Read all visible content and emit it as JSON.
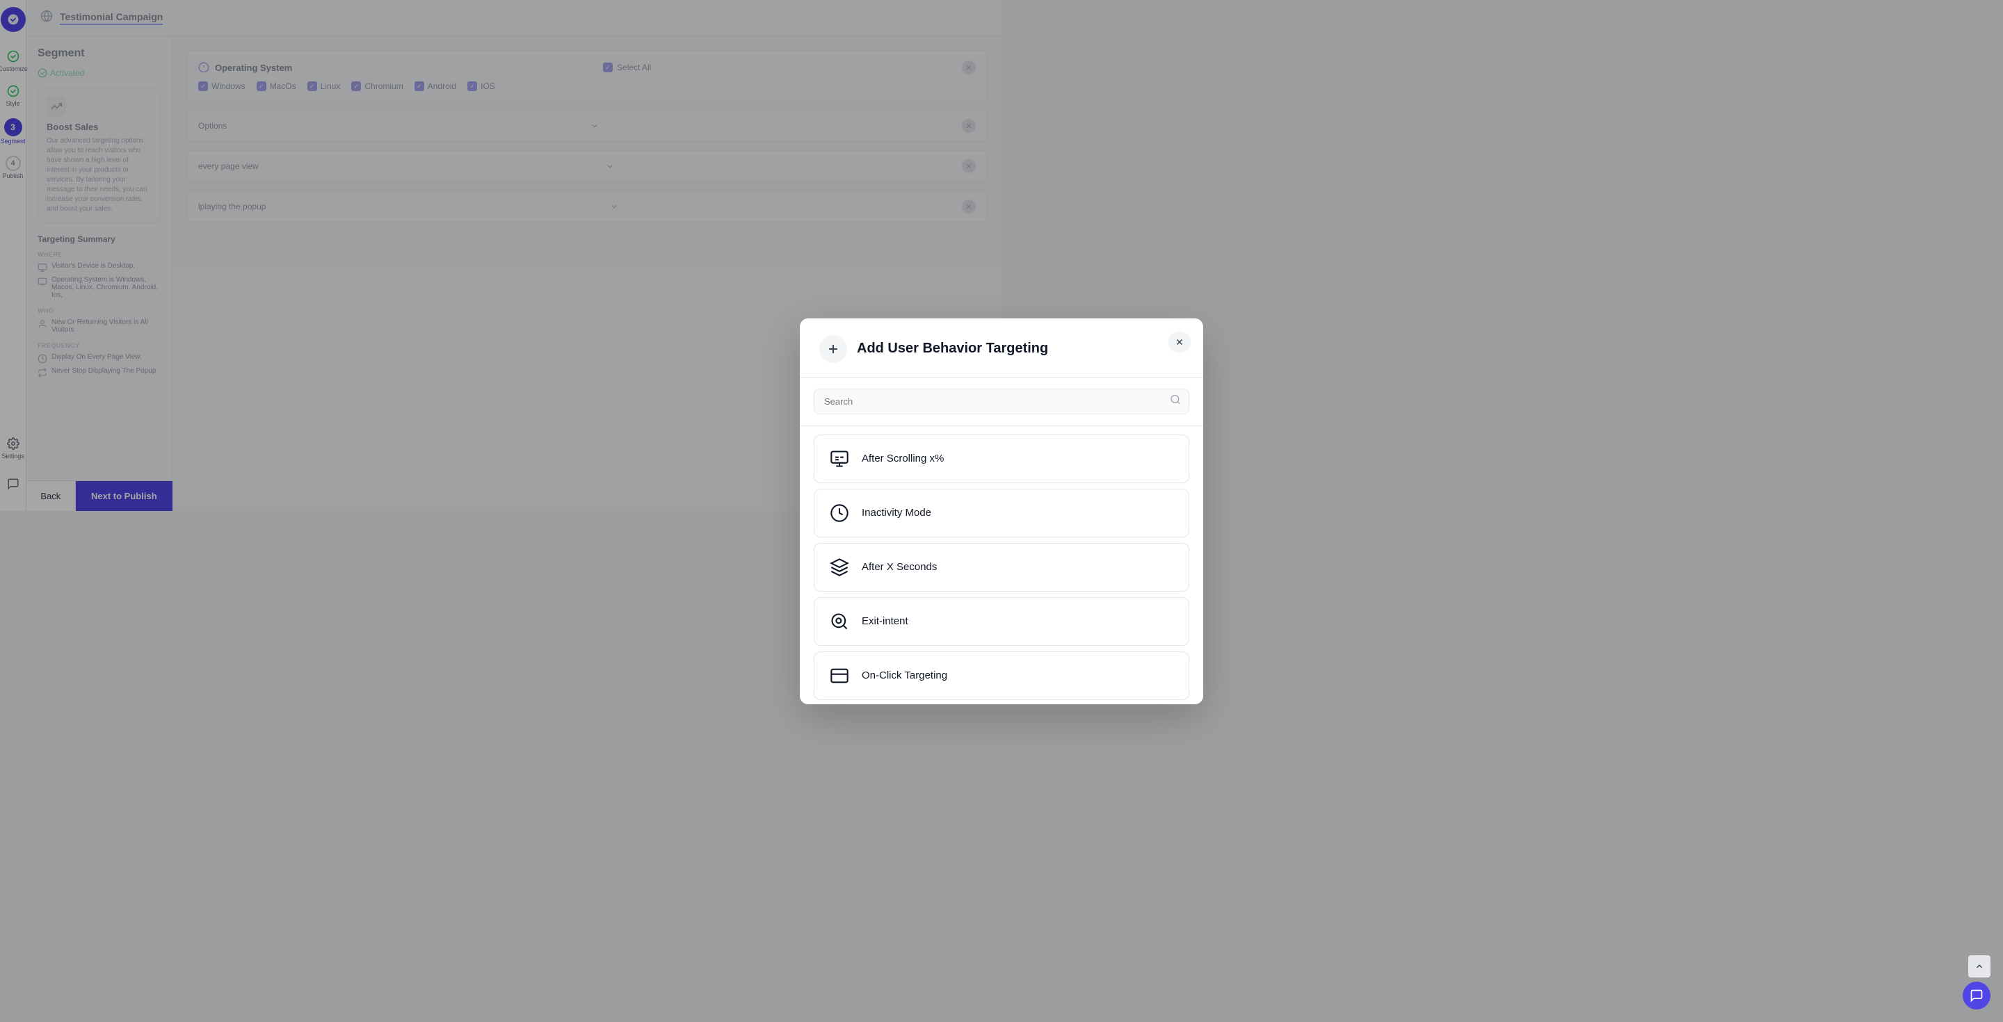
{
  "header": {
    "title": "Testimonial Campaign"
  },
  "sidebar": {
    "logo_label": "App Logo",
    "items": [
      {
        "label": "Customize",
        "icon": "check-circle",
        "step": null
      },
      {
        "label": "Style",
        "icon": "check-circle",
        "step": null
      },
      {
        "label": "Segment",
        "icon": null,
        "step": "3",
        "active": true
      },
      {
        "label": "Publish",
        "icon": null,
        "step": "4"
      }
    ],
    "bottom_items": [
      {
        "label": "Settings",
        "icon": "gear"
      }
    ]
  },
  "left_panel": {
    "title": "Segment",
    "activated_label": "Activated",
    "boost_sales": {
      "title": "Boost Sales",
      "description": "Our advanced targeting options allow you to reach visitors who have shown a high level of interest in your products or services. By tailoring your message to their needs, you can increase your conversion rates and boost your sales."
    },
    "targeting_summary": {
      "title": "Targeting Summary",
      "sections": [
        {
          "label": "WHERE",
          "items": [
            "Visitor's Device is Desktop,",
            "Operating System is Windows, Macos, Linux, Chromium, Android, Ios,"
          ]
        },
        {
          "label": "WHO",
          "items": [
            "New Or Returning Visitors is All Visitors"
          ]
        },
        {
          "label": "FREQUENCY",
          "items": [
            "Display On Every Page View.",
            "Never Stop Displaying The Popup"
          ]
        }
      ]
    }
  },
  "right_content": {
    "os_section": {
      "label": "Operating System",
      "select_all": "Select All",
      "options": [
        "Windows",
        "MacOs",
        "Linux",
        "Chromium",
        "Android",
        "IOS"
      ]
    }
  },
  "modal": {
    "title": "Add User Behavior Targeting",
    "search_placeholder": "Search",
    "close_label": "Close",
    "items": [
      {
        "id": "after-scrolling",
        "label": "After Scrolling x%",
        "icon": "scroll"
      },
      {
        "id": "inactivity-mode",
        "label": "Inactivity Mode",
        "icon": "clock"
      },
      {
        "id": "after-x-seconds",
        "label": "After X Seconds",
        "icon": "timer"
      },
      {
        "id": "exit-intent",
        "label": "Exit-intent",
        "icon": "exit"
      },
      {
        "id": "on-click-targeting",
        "label": "On-Click Targeting",
        "icon": "click"
      }
    ]
  },
  "bottom_bar": {
    "back_label": "Back",
    "next_label": "Next to Publish"
  },
  "colors": {
    "primary": "#4f46e5",
    "success": "#22c55e",
    "text_dark": "#111827",
    "text_mid": "#374151",
    "text_light": "#6b7280",
    "border": "#e5e7eb"
  }
}
